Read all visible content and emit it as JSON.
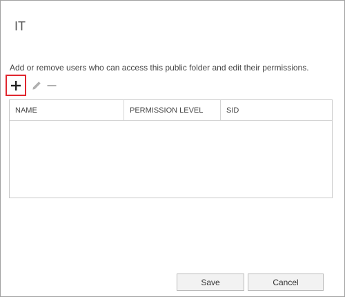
{
  "dialog": {
    "title": "IT",
    "description": "Add or remove users who can access this public folder and edit their permissions."
  },
  "toolbar": {
    "add_icon": "plus-icon",
    "edit_icon": "pencil-icon",
    "remove_icon": "minus-icon",
    "highlight_color": "#e0262e"
  },
  "grid": {
    "columns": [
      "NAME",
      "PERMISSION LEVEL",
      "SID"
    ],
    "rows": []
  },
  "buttons": {
    "save_label": "Save",
    "cancel_label": "Cancel"
  }
}
